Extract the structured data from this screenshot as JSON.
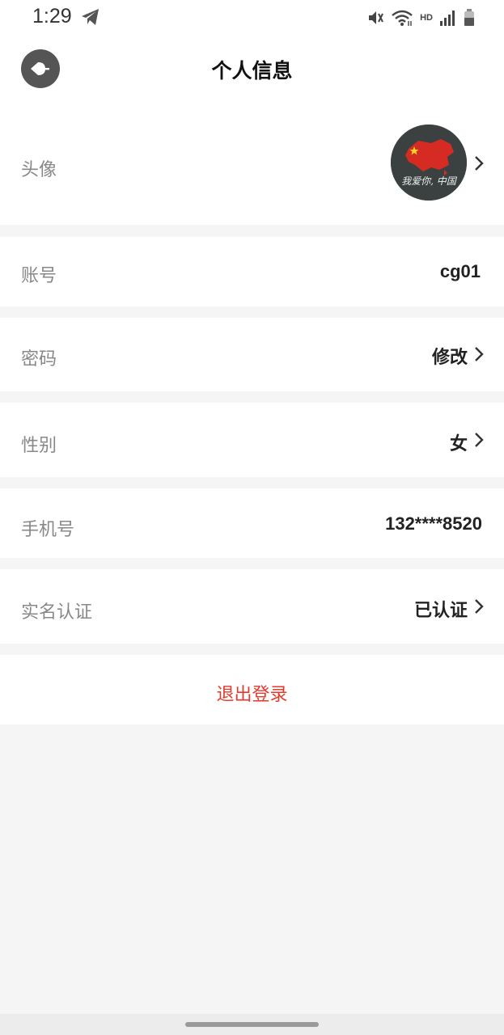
{
  "status_bar": {
    "time": "1:29",
    "hd": "HD",
    "icons": [
      "telegram-icon",
      "mute-icon",
      "wifi-icon",
      "signal-icon",
      "battery-icon"
    ]
  },
  "header": {
    "title": "个人信息",
    "back_icon": "back-icon"
  },
  "rows": {
    "avatar": {
      "label": "头像",
      "image_caption": "我爱你, 中国"
    },
    "account": {
      "label": "账号",
      "value": "cg01"
    },
    "password": {
      "label": "密码",
      "value": "修改"
    },
    "gender": {
      "label": "性别",
      "value": "女"
    },
    "phone": {
      "label": "手机号",
      "value": "132****8520"
    },
    "realname": {
      "label": "实名认证",
      "value": "已认证"
    }
  },
  "logout": {
    "label": "退出登录"
  },
  "colors": {
    "accent_red": "#e23b2e",
    "background": "#f5f5f5",
    "card": "#ffffff"
  }
}
